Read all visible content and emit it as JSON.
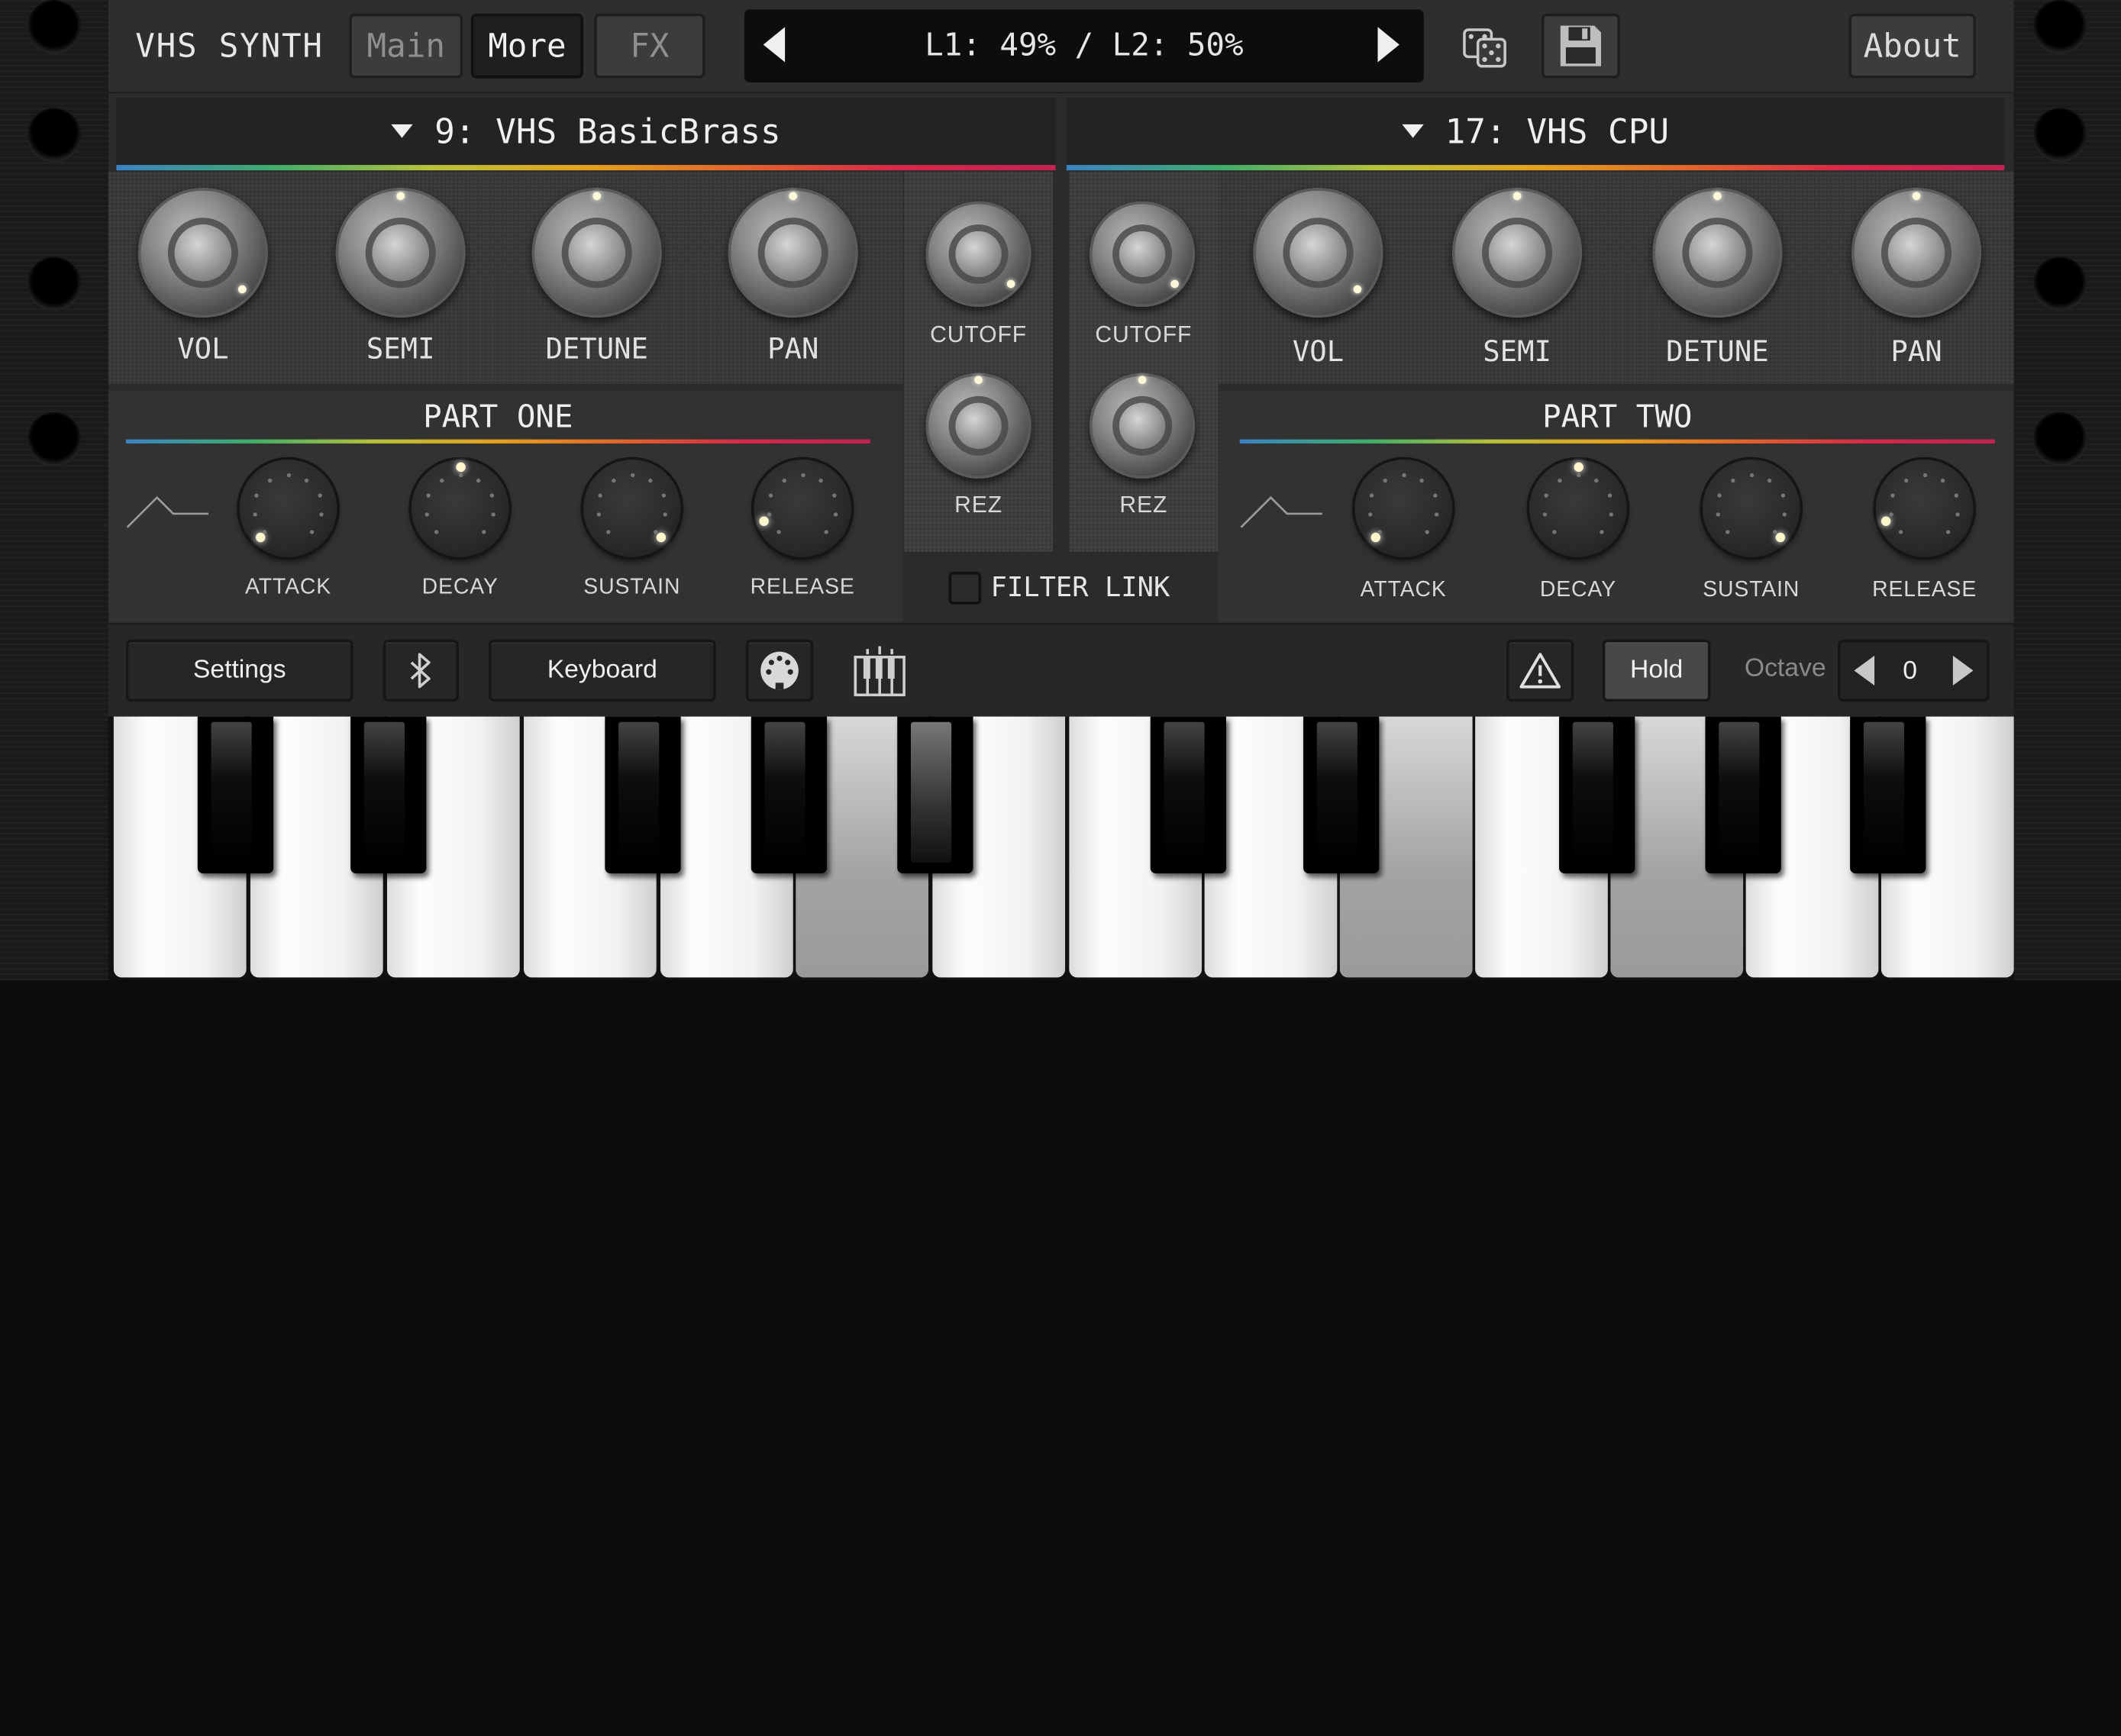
{
  "app": {
    "title": "VHS SYNTH"
  },
  "tabs": [
    {
      "label": "Main",
      "active": false
    },
    {
      "label": "More",
      "active": true
    },
    {
      "label": "FX",
      "active": false
    }
  ],
  "lcd": {
    "text": "L1: 49% / L2: 50%"
  },
  "topbar": {
    "about_label": "About"
  },
  "part_one": {
    "preset": "9: VHS BasicBrass",
    "title": "PART ONE",
    "knobs": [
      "VOL",
      "SEMI",
      "DETUNE",
      "PAN"
    ],
    "filter": [
      "CUTOFF",
      "REZ"
    ],
    "envelope": [
      "ATTACK",
      "DECAY",
      "SUSTAIN",
      "RELEASE"
    ]
  },
  "part_two": {
    "preset": "17: VHS CPU",
    "title": "PART TWO",
    "knobs": [
      "VOL",
      "SEMI",
      "DETUNE",
      "PAN"
    ],
    "filter": [
      "CUTOFF",
      "REZ"
    ],
    "envelope": [
      "ATTACK",
      "DECAY",
      "SUSTAIN",
      "RELEASE"
    ]
  },
  "filter_link": {
    "label": "FILTER LINK",
    "checked": false
  },
  "bottombar": {
    "settings_label": "Settings",
    "keyboard_label": "Keyboard",
    "hold_label": "Hold",
    "octave_label": "Octave",
    "octave_value": "0"
  },
  "icons": {
    "dice": "dice-icon",
    "save": "floppy-save-icon",
    "bluetooth": "bluetooth-icon",
    "midi": "midi-icon",
    "piano": "piano-icon",
    "warning": "warning-icon"
  },
  "colors": {
    "rainbow": [
      "#3b83c4",
      "#3dae6b",
      "#b7c23a",
      "#e6a11d",
      "#e2642a",
      "#d8274a"
    ]
  }
}
